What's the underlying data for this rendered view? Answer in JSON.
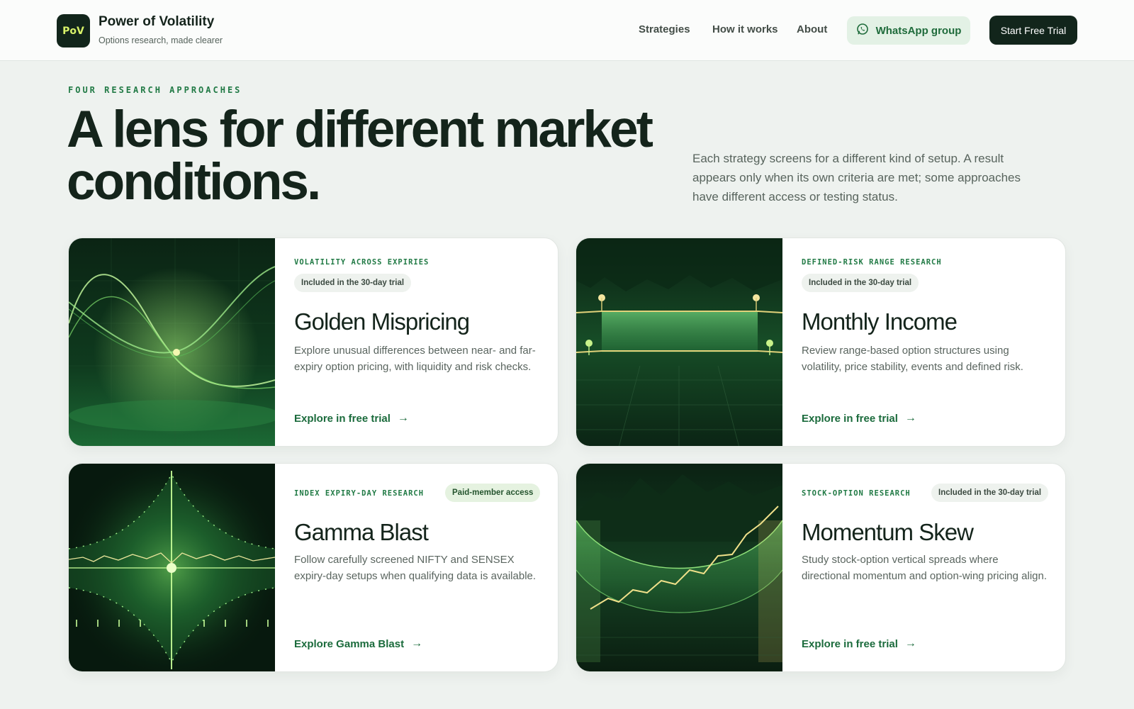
{
  "brand": {
    "logo_text": "PoV",
    "name": "Power of Volatility",
    "tagline": "Options research, made clearer"
  },
  "nav": {
    "items": [
      "Strategies",
      "How it works",
      "About"
    ],
    "whatsapp_label": "WhatsApp group",
    "cta_label": "Start Free Trial"
  },
  "hero": {
    "eyebrow": "FOUR RESEARCH APPROACHES",
    "headline": "A lens for different market conditions.",
    "intro": "Each strategy screens for a different kind of setup. A result appears only when its own criteria are met; some approaches have different access or testing status."
  },
  "cards": [
    {
      "kicker": "VOLATILITY ACROSS EXPIRIES",
      "badge": "Included in the 30-day trial",
      "title": "Golden Mispricing",
      "description": "Explore unusual differences between near- and far-expiry option pricing, with liquidity and risk checks.",
      "link": "Explore in free trial",
      "arrow": "→"
    },
    {
      "kicker": "DEFINED-RISK RANGE RESEARCH",
      "badge": "Included in the 30-day trial",
      "title": "Monthly Income",
      "description": "Review range-based option structures using volatility, price stability, events and defined risk.",
      "link": "Explore in free trial",
      "arrow": "→"
    },
    {
      "kicker": "INDEX EXPIRY-DAY RESEARCH",
      "badge": "Paid-member access",
      "title": "Gamma Blast",
      "description": "Follow carefully screened NIFTY and SENSEX expiry-day setups when qualifying data is available.",
      "link": "Explore Gamma Blast",
      "arrow": "→"
    },
    {
      "kicker": "STOCK-OPTION RESEARCH",
      "badge": "Included in the 30-day trial",
      "title": "Momentum Skew",
      "description": "Study stock-option vertical spreads where directional momentum and option-wing pricing align.",
      "link": "Explore in free trial",
      "arrow": "→"
    }
  ],
  "colors": {
    "accent": "#1b6b3c",
    "dark": "#12251b",
    "background": "#eef2ef",
    "logo_text": "#d8f26a"
  },
  "icons": {
    "whatsapp": "whatsapp-icon",
    "arrow": "arrow-right-icon"
  }
}
